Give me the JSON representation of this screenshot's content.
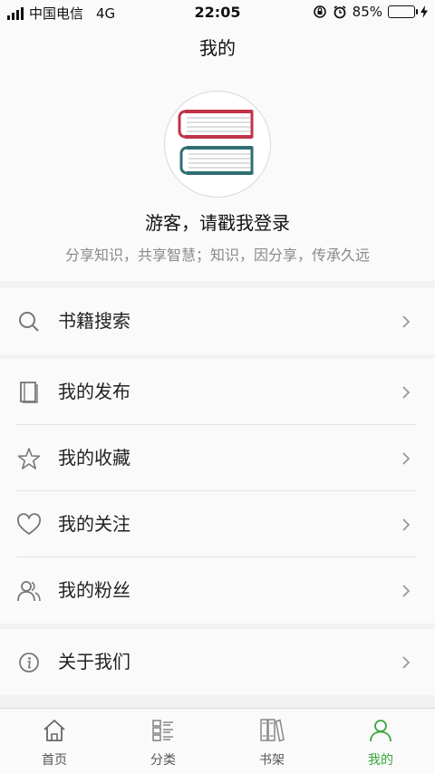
{
  "status": {
    "carrier": "中国电信",
    "network": "4G",
    "time": "22:05",
    "battery": "85%",
    "battery_level": 0.85
  },
  "header": {
    "title": "我的"
  },
  "profile": {
    "name": "游客，请戳我登录",
    "slogan": "分享知识，共享智慧；知识，因分享，传承久远"
  },
  "menu": {
    "search": {
      "label": "书籍搜索",
      "icon": "search-icon"
    },
    "items": [
      {
        "label": "我的发布",
        "icon": "book-icon"
      },
      {
        "label": "我的收藏",
        "icon": "star-icon"
      },
      {
        "label": "我的关注",
        "icon": "heart-icon"
      },
      {
        "label": "我的粉丝",
        "icon": "users-icon"
      }
    ],
    "about": {
      "label": "关于我们",
      "icon": "info-icon"
    }
  },
  "tabs": [
    {
      "label": "首页",
      "icon": "home-icon",
      "active": false
    },
    {
      "label": "分类",
      "icon": "category-icon",
      "active": false
    },
    {
      "label": "书架",
      "icon": "bookshelf-icon",
      "active": false
    },
    {
      "label": "我的",
      "icon": "user-icon",
      "active": true
    }
  ],
  "colors": {
    "accent": "#3aa63a",
    "battery": "#4cd964",
    "book_top": "#c0344a",
    "book_bottom": "#2f6f73"
  }
}
